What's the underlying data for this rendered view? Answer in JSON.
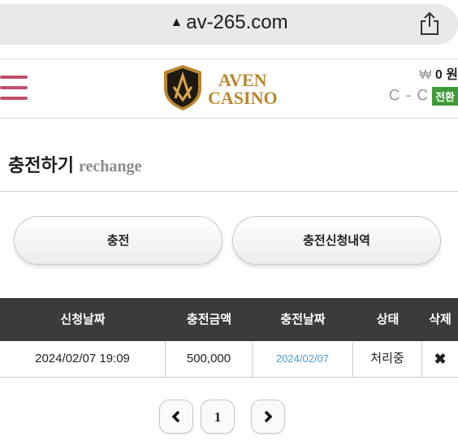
{
  "browser": {
    "url": "av-265.com"
  },
  "header": {
    "logo_line1": "AVEN",
    "logo_line2": "CASINO",
    "currency_symbol": "₩",
    "balance": "0 원",
    "convert_indicator": "C - C",
    "convert_label": "전환"
  },
  "page": {
    "title": "충전하기",
    "subtitle": "rechange"
  },
  "tabs": [
    {
      "label": "충전"
    },
    {
      "label": "충전신청내역"
    }
  ],
  "table": {
    "headers": [
      "신청날짜",
      "충전금액",
      "충전날짜",
      "상태",
      "삭제"
    ],
    "rows": [
      {
        "request_date": "2024/02/07 19:09",
        "amount": "500,000",
        "charge_date": "2024/02/07",
        "status": "처리중",
        "delete": "✖"
      }
    ]
  },
  "pagination": {
    "current": "1"
  },
  "colors": {
    "menu": "#c0506a",
    "logo_gold": "#b8872f",
    "convert_green": "#3e9b38",
    "link_blue": "#4e9bcf",
    "table_header": "#3b3b3b"
  }
}
